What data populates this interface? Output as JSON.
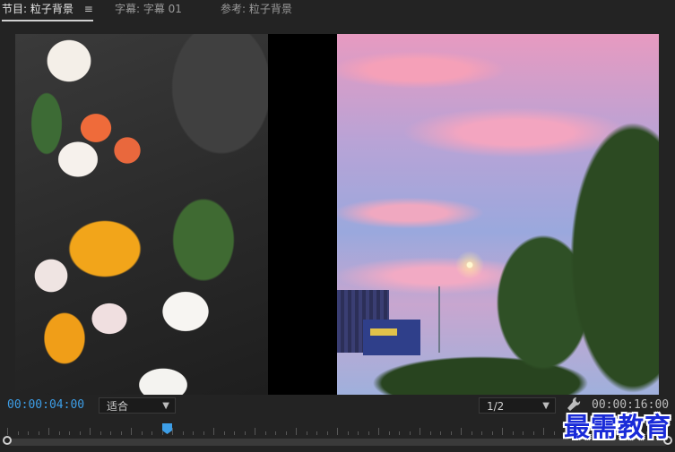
{
  "tabs": [
    {
      "label": "节目: 粒子背景",
      "active": true
    },
    {
      "label": "字幕: 字幕 01",
      "active": false
    },
    {
      "label": "参考: 粒子背景",
      "active": false
    }
  ],
  "panel_menu_icon": "hamburger-menu-icon",
  "playback": {
    "current_timecode": "00:00:04:00",
    "duration_timecode": "00:00:16:00",
    "zoom_value": "适合",
    "resolution_value": "1/2"
  },
  "settings_icon": "wrench-icon",
  "watermark": "最需教育",
  "colors": {
    "accent_blue": "#3d9ee7",
    "background": "#232323",
    "watermark_blue": "#1a2bd8"
  }
}
